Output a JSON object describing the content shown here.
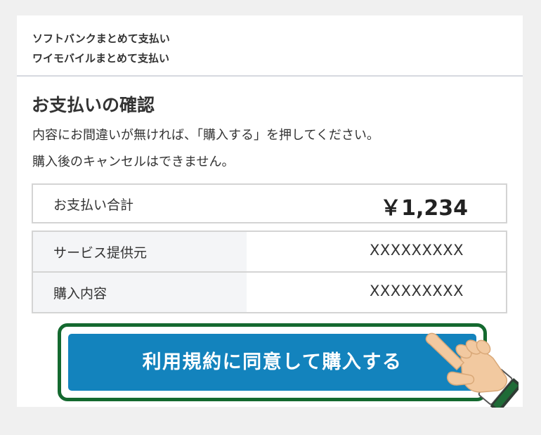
{
  "header": {
    "line1": "ソフトバンクまとめて支払い",
    "line2": "ワイモバイルまとめて支払い"
  },
  "main": {
    "title": "お支払いの確認",
    "description_line1": "内容にお間違いが無ければ、「購入する」を押してください。",
    "description_line2": "購入後のキャンセルはできません。"
  },
  "total": {
    "label": "お支払い合計",
    "amount": "￥1,234"
  },
  "details": [
    {
      "label": "サービス提供元",
      "value": "XXXXXXXXX"
    },
    {
      "label": "購入内容",
      "value": "XXXXXXXXX"
    }
  ],
  "cta": {
    "label": "利用規約に同意して購入する"
  },
  "icons": {
    "pointer": "pointing-hand-icon"
  },
  "colors": {
    "button": "#1383bd",
    "button_frame": "#14692f",
    "page_background": "#f0f0f0"
  }
}
